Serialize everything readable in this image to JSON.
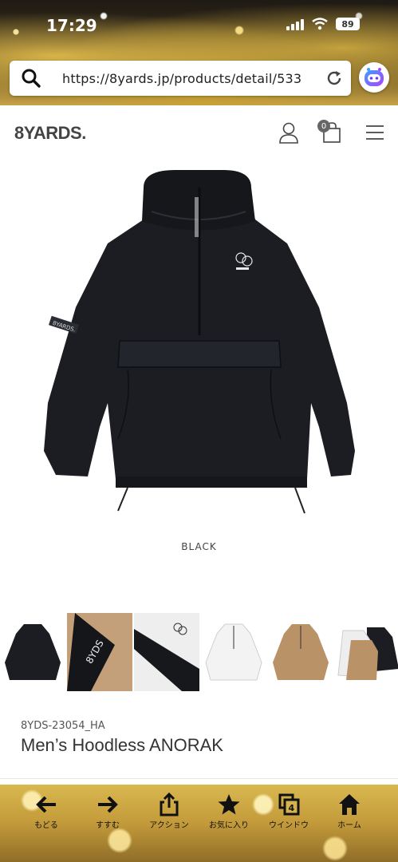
{
  "status_bar": {
    "time": "17:29",
    "battery": "89"
  },
  "browser": {
    "url": "https://8yards.jp/products/detail/533"
  },
  "site": {
    "logo": "8YARDS.",
    "cart_count": "0"
  },
  "product": {
    "color": "BLACK",
    "sku": "8YDS-23054_HA",
    "title": "Men’s Hoodless ANORAK",
    "sleeve_label": "8YARDS.",
    "thumbnails": [
      "black-front",
      "beige-detail",
      "white-detail",
      "white-front",
      "beige-front",
      "multi-pair"
    ]
  },
  "toolbar": {
    "items": [
      {
        "label": "もどる",
        "icon": "arrow-left-icon"
      },
      {
        "label": "すすむ",
        "icon": "arrow-right-icon"
      },
      {
        "label": "アクション",
        "icon": "share-icon"
      },
      {
        "label": "お気に入り",
        "icon": "star-icon"
      },
      {
        "label": "ウインドウ",
        "icon": "windows-icon",
        "count": "4"
      },
      {
        "label": "ホーム",
        "icon": "home-icon"
      }
    ]
  },
  "colors": {
    "accent_gold": "#c8a448",
    "jacket": "#1b1d22"
  }
}
